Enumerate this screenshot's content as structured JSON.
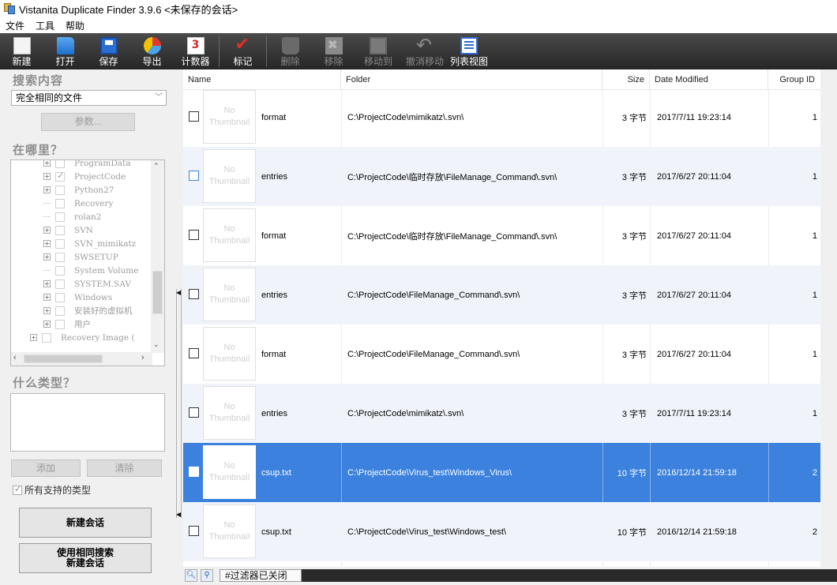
{
  "window": {
    "title": "Vistanita Duplicate Finder 3.9.6 <未保存的会话>"
  },
  "menu": [
    "文件",
    "工具",
    "帮助"
  ],
  "toolbar": {
    "new": "新建",
    "open": "打开",
    "save": "保存",
    "export": "导出",
    "counter": "计数器",
    "mark": "标记",
    "delete": "删除",
    "remove": "移除",
    "move_to": "移动到",
    "undo_move": "撤消移动",
    "list_view": "列表视图"
  },
  "left": {
    "search_title": "搜索内容",
    "search_mode": "完全相同的文件",
    "params_button": "参数...",
    "where_title": "在哪里？",
    "tree": [
      {
        "label": "ProgramData",
        "expand": true,
        "checked": false,
        "level": 2
      },
      {
        "label": "ProjectCode",
        "expand": true,
        "checked": true,
        "level": 2
      },
      {
        "label": "Python27",
        "expand": true,
        "checked": false,
        "level": 2
      },
      {
        "label": "Recovery",
        "expand": false,
        "checked": false,
        "level": 2
      },
      {
        "label": "rolan2",
        "expand": false,
        "checked": false,
        "level": 2
      },
      {
        "label": "SVN",
        "expand": true,
        "checked": false,
        "level": 2
      },
      {
        "label": "SVN_mimikatz",
        "expand": true,
        "checked": false,
        "level": 2
      },
      {
        "label": "SWSETUP",
        "expand": true,
        "checked": false,
        "level": 2
      },
      {
        "label": "System Volume",
        "expand": false,
        "checked": false,
        "level": 2
      },
      {
        "label": "SYSTEM.SAV",
        "expand": true,
        "checked": false,
        "level": 2
      },
      {
        "label": "Windows",
        "expand": true,
        "checked": false,
        "level": 2
      },
      {
        "label": "安装好的虚拟机",
        "expand": true,
        "checked": false,
        "level": 2
      },
      {
        "label": "用户",
        "expand": true,
        "checked": false,
        "level": 2
      },
      {
        "label": "Recovery Image (",
        "expand": true,
        "checked": false,
        "level": 1
      }
    ],
    "type_title": "什么类型？",
    "add_button": "添加",
    "clear_button": "清除",
    "all_types_label": "所有支持的类型",
    "new_session_button": "新建会话",
    "new_session_same_line1": "使用相同搜索",
    "new_session_same_line2": "新建会话"
  },
  "list": {
    "columns": {
      "name": "Name",
      "folder": "Folder",
      "size": "Size",
      "date": "Date Modified",
      "group": "Group ID"
    },
    "thumb_line1": "No",
    "thumb_line2": "Thumbnail",
    "rows": [
      {
        "name": "format",
        "folder": "C:\\ProjectCode\\mimikatz\\.svn\\",
        "size": "3 字节",
        "date": "2017/7/11 19:23:14",
        "group": "1"
      },
      {
        "name": "entries",
        "folder": "C:\\ProjectCode\\临时存放\\FileManage_Command\\.svn\\",
        "size": "3 字节",
        "date": "2017/6/27 20:11:04",
        "group": "1"
      },
      {
        "name": "format",
        "folder": "C:\\ProjectCode\\临时存放\\FileManage_Command\\.svn\\",
        "size": "3 字节",
        "date": "2017/6/27 20:11:04",
        "group": "1"
      },
      {
        "name": "entries",
        "folder": "C:\\ProjectCode\\FileManage_Command\\.svn\\",
        "size": "3 字节",
        "date": "2017/6/27 20:11:04",
        "group": "1"
      },
      {
        "name": "format",
        "folder": "C:\\ProjectCode\\FileManage_Command\\.svn\\",
        "size": "3 字节",
        "date": "2017/6/27 20:11:04",
        "group": "1"
      },
      {
        "name": "entries",
        "folder": "C:\\ProjectCode\\mimikatz\\.svn\\",
        "size": "3 字节",
        "date": "2017/7/11 19:23:14",
        "group": "1"
      },
      {
        "name": "csup.txt",
        "folder": "C:\\ProjectCode\\Virus_test\\Windows_Virus\\",
        "size": "10 字节",
        "date": "2016/12/14 21:59:18",
        "group": "2"
      },
      {
        "name": "csup.txt",
        "folder": "C:\\ProjectCode\\Virus_test\\Windows_test\\",
        "size": "10 字节",
        "date": "2016/12/14 21:59:18",
        "group": "2"
      }
    ]
  },
  "status": {
    "filter": "#过滤器已关闭"
  }
}
